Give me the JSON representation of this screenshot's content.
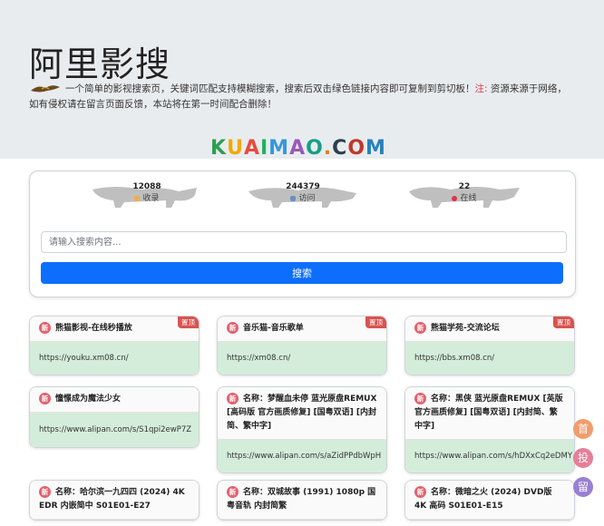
{
  "header": {
    "title": "阿里影搜",
    "intro_text": "一个简单的影视搜索页，关键词匹配支持模糊搜索，搜索后双击绿色链接内容即可复制到剪切板！",
    "note_label": "注:",
    "note_text": "资源来源于网络，如有侵权请在留言页面反馈，本站将在第一时间配合删除！",
    "brand": [
      "K",
      "U",
      "A",
      "I",
      "M",
      "A",
      "O",
      ".",
      "C",
      "O",
      "M"
    ],
    "brand_colors": [
      "#2e9e4f",
      "#f2a900",
      "#e74c3c",
      "#27ae60",
      "#3498db",
      "#9b59b6",
      "#16a085",
      "#e67e22",
      "#2c3e50",
      "#c0392b",
      "#2980b9"
    ]
  },
  "stats": [
    {
      "value": "12088",
      "label": "收录",
      "color": "#f0ad4e"
    },
    {
      "value": "244379",
      "label": "访问",
      "color": "#6c8ebf"
    },
    {
      "value": "22",
      "label": "在线",
      "color": "#dc3545"
    }
  ],
  "search": {
    "placeholder": "请输入搜索内容...",
    "button_label": "搜索"
  },
  "cards": [
    {
      "badge": "新",
      "title": "熊猫影视-在线秒播放",
      "url": "https://youku.xm08.cn/",
      "ribbon": "置顶"
    },
    {
      "badge": "新",
      "title": "音乐猫-音乐歌单",
      "url": "https://xm08.cn/",
      "ribbon": "置顶"
    },
    {
      "badge": "新",
      "title": "熊猫学苑-交流论坛",
      "url": "https://bbs.xm08.cn/",
      "ribbon": "置顶"
    },
    {
      "badge": "新",
      "title": "憧憬成为魔法少女",
      "url": "https://www.alipan.com/s/S1qpi2ewP7Z",
      "ribbon": ""
    },
    {
      "badge": "新",
      "title": "名称：梦醒血未停 蓝光原盘REMUX [高码版 官方画质修复] [国粤双语] [内封简、繁中字]",
      "url": "https://www.alipan.com/s/aZidPPdbWpH",
      "ribbon": ""
    },
    {
      "badge": "新",
      "title": "名称：黑侠 蓝光原盘REMUX [英版 官方画质修复] [国粤双语] [内封简、繁中字]",
      "url": "https://www.alipan.com/s/hDXxCq2eDMY",
      "ribbon": ""
    },
    {
      "badge": "新",
      "title": "名称：哈尔滨一九四四 (2024) 4K EDR 内嵌简中 S01E01-E27",
      "url": "",
      "ribbon": ""
    },
    {
      "badge": "新",
      "title": "名称：双城故事 (1991) 1080p 国粤音轨 内封简繁",
      "url": "",
      "ribbon": ""
    },
    {
      "badge": "新",
      "title": "名称：微暗之火 (2024) DVD版 4K 高码 S01E01-E15",
      "url": "",
      "ribbon": ""
    }
  ],
  "float_buttons": [
    {
      "label": "首",
      "color": "#f39c6b"
    },
    {
      "label": "投",
      "color": "#e67e9a"
    },
    {
      "label": "留",
      "color": "#9b7fd4"
    }
  ]
}
